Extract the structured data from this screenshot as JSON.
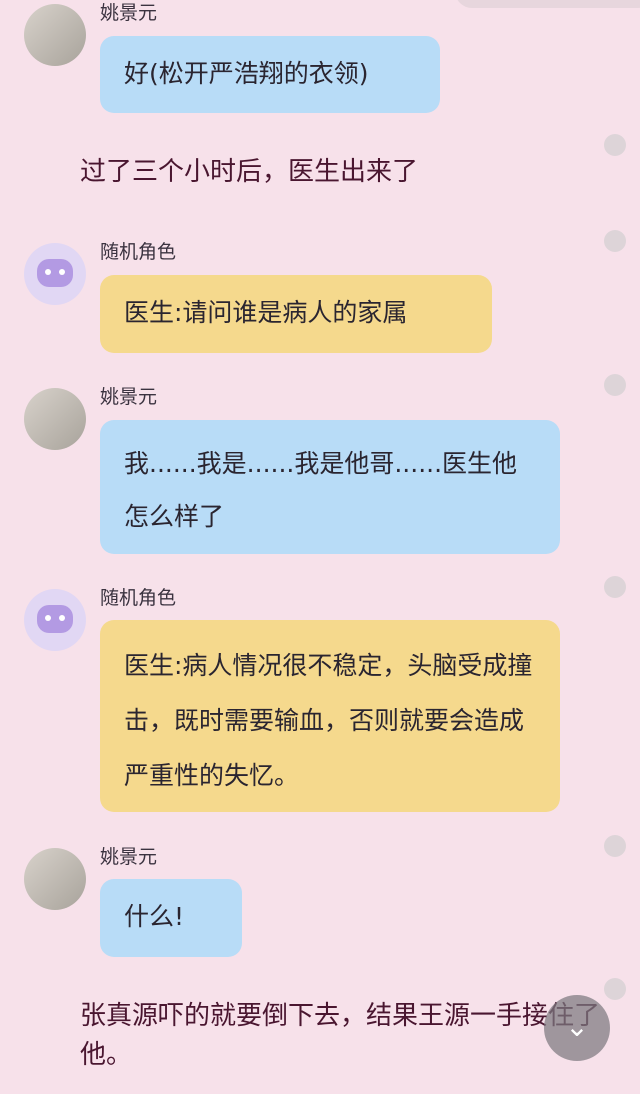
{
  "top_bar": {
    "partial_label": ""
  },
  "messages": [
    {
      "type": "message",
      "speaker": "姚景元",
      "avatar": "photo",
      "bubble_color": "blue",
      "text": "好(松开严浩翔的衣领)"
    },
    {
      "type": "narration",
      "text": "过了三个小时后，医生出来了"
    },
    {
      "type": "message",
      "speaker": "随机角色",
      "avatar": "random",
      "bubble_color": "yellow",
      "text": "医生:请问谁是病人的家属"
    },
    {
      "type": "message",
      "speaker": "姚景元",
      "avatar": "photo",
      "bubble_color": "blue",
      "text": "我......我是......我是他哥......医生他怎么样了"
    },
    {
      "type": "message",
      "speaker": "随机角色",
      "avatar": "random",
      "bubble_color": "yellow",
      "text": "医生:病人情况很不稳定，头脑受成撞击，既时需要输血，否则就要会造成严重性的失忆。"
    },
    {
      "type": "message",
      "speaker": "姚景元",
      "avatar": "photo",
      "bubble_color": "blue",
      "text": "什么!"
    },
    {
      "type": "narration",
      "text": "张真源吓的就要倒下去，结果王源一手接住了他。"
    }
  ],
  "controls": {
    "scroll_down_icon": "chevron-down-icon"
  },
  "colors": {
    "background": "#f7e1ea",
    "blue_bubble": "#b8dcf7",
    "yellow_bubble": "#f5d98d",
    "narration_text": "#4a1630",
    "dot": "#ddd4d8"
  }
}
